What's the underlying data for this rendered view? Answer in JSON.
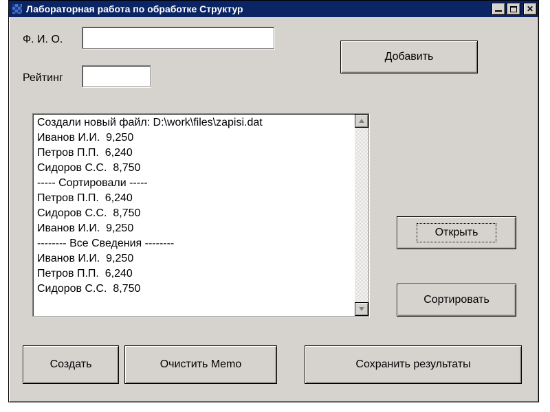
{
  "window": {
    "title": "Лабораторная работа по обработке Структур"
  },
  "labels": {
    "fio": "Ф. И. О.",
    "rating": "Рейтинг"
  },
  "inputs": {
    "fio": "",
    "rating": ""
  },
  "buttons": {
    "add": "Добавить",
    "open": "Открыть",
    "sort": "Сортировать",
    "create": "Создать",
    "clear_memo": "Очистить Memo",
    "save_results": "Сохранить результаты"
  },
  "memo_lines": [
    "Создали новый файл: D:\\work\\files\\zapisi.dat",
    "Иванов И.И.  9,250",
    "Петров П.П.  6,240",
    "Сидоров С.С.  8,750",
    "----- Сортировали -----",
    "Петров П.П.  6,240",
    "Сидоров С.С.  8,750",
    "Иванов И.И.  9,250",
    "-------- Все Сведения --------",
    "Иванов И.И.  9,250",
    "Петров П.П.  6,240",
    "Сидоров С.С.  8,750"
  ]
}
